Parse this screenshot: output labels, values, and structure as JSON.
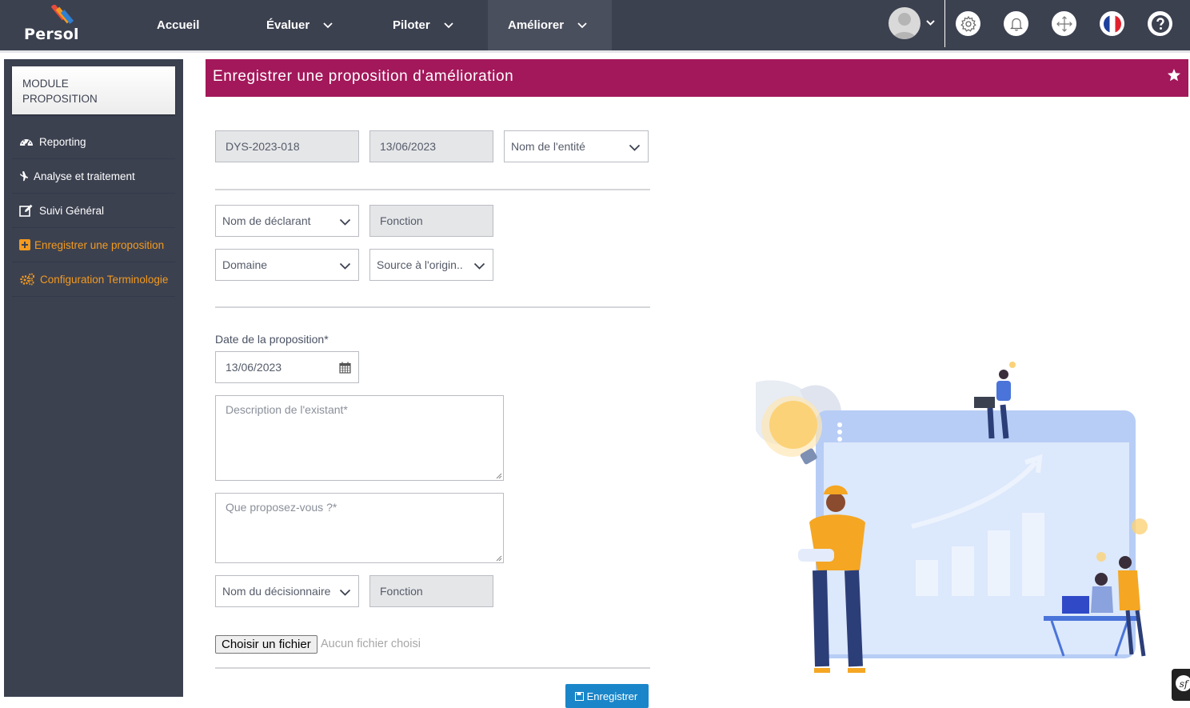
{
  "app": {
    "logo_text": "Persol"
  },
  "nav": {
    "accueil": "Accueil",
    "evaluer": "Évaluer",
    "piloter": "Piloter",
    "ameliorer": "Améliorer"
  },
  "sidebar": {
    "module_line1": "MODULE",
    "module_line2": "PROPOSITION",
    "items": [
      {
        "label": "Reporting",
        "icon": "dashboard-icon"
      },
      {
        "label": "Analyse et traitement",
        "icon": "plane-icon"
      },
      {
        "label": "Suivi Général",
        "icon": "edit-icon"
      },
      {
        "label": "Enregistrer une proposition",
        "icon": "plus-square-icon"
      },
      {
        "label": "Configuration Terminologie",
        "icon": "cogs-icon"
      }
    ]
  },
  "header": {
    "title": "Enregistrer une proposition d'amélioration"
  },
  "form": {
    "reference": "DYS-2023-018",
    "date_creation": "13/06/2023",
    "entite_placeholder": "Nom de l'entité",
    "declarant_placeholder": "Nom de déclarant",
    "fonction_placeholder": "Fonction",
    "domaine_placeholder": "Domaine",
    "source_placeholder": "Source à l'origin..",
    "date_label": "Date de la proposition*",
    "date_value": "13/06/2023",
    "description_placeholder": "Description de l'existant*",
    "proposition_placeholder": "Que proposez-vous ?*",
    "decisionnaire_placeholder": "Nom du décisionnaire",
    "fonction2_placeholder": "Fonction",
    "file_button": "Choisir un fichier",
    "file_status": "Aucun fichier choisi",
    "save_label": "Enregistrer"
  },
  "colors": {
    "nav_bg": "#3c4150",
    "header_bg": "#a3185a",
    "accent_orange": "#f39a1f",
    "save_blue": "#1a86c9"
  }
}
